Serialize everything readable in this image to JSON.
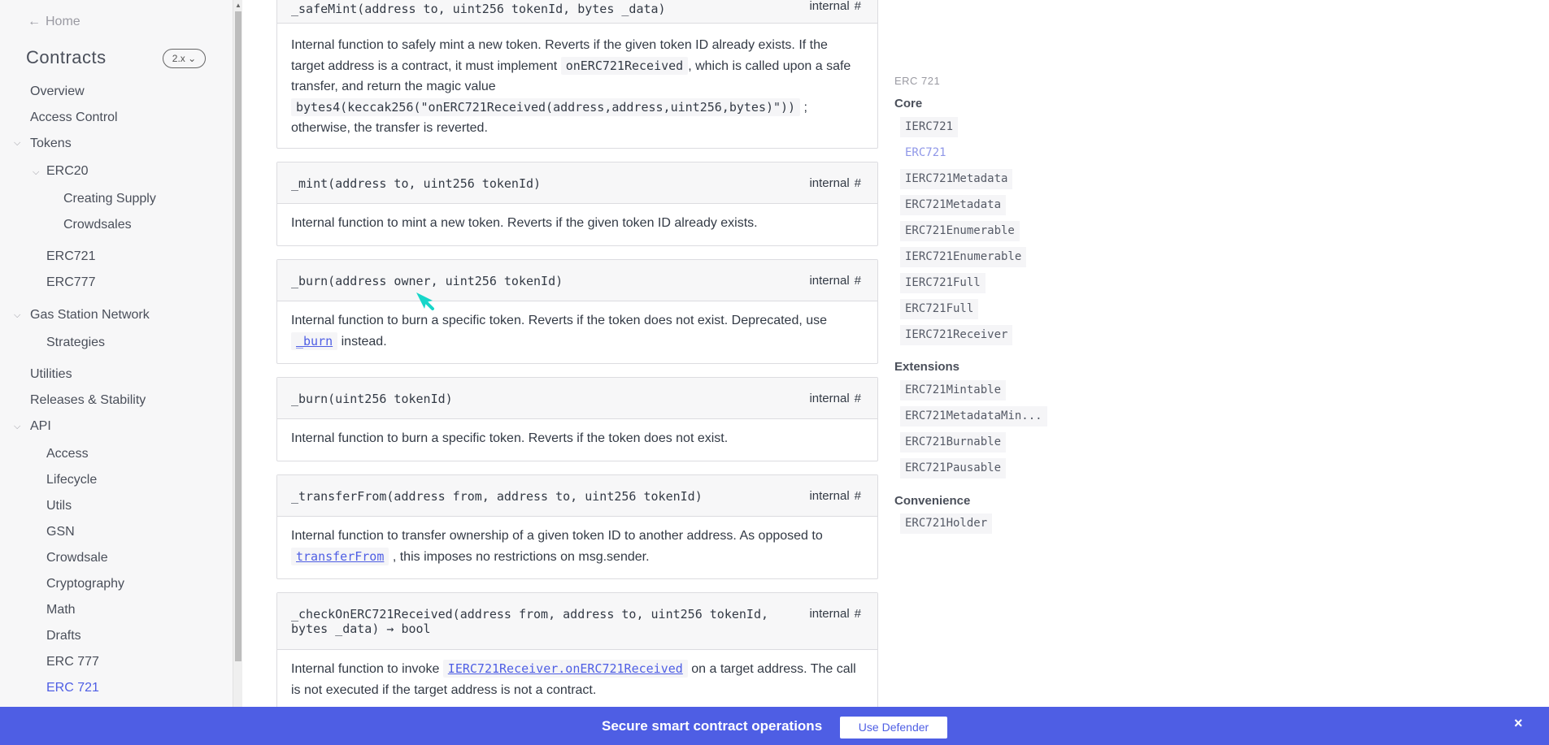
{
  "sidebar": {
    "home": "Home",
    "title": "Contracts",
    "version": "2.x",
    "items": {
      "overview": "Overview",
      "access_control": "Access Control",
      "tokens": "Tokens",
      "erc20": "ERC20",
      "creating_supply": "Creating Supply",
      "crowdsales": "Crowdsales",
      "erc721": "ERC721",
      "erc777": "ERC777",
      "gsn": "Gas Station Network",
      "strategies": "Strategies",
      "utilities": "Utilities",
      "releases": "Releases & Stability",
      "api": "API",
      "api_access": "Access",
      "api_lifecycle": "Lifecycle",
      "api_utils": "Utils",
      "api_gsn": "GSN",
      "api_crowdsale": "Crowdsale",
      "api_cryptography": "Cryptography",
      "api_math": "Math",
      "api_drafts": "Drafts",
      "api_erc777": "ERC 777",
      "api_erc721": "ERC 721"
    }
  },
  "main": {
    "safemint": {
      "sig": "_safeMint(address to, uint256 tokenId, bytes _data)",
      "visibility": "internal",
      "anchor": "#",
      "desc_1": "Internal function to safely mint a new token. Reverts if the given token ID already exists. If the target address is a contract, it must implement",
      "code_1": "onERC721Received",
      "desc_2": ", which is called upon a safe transfer, and return the magic value",
      "code_2": "bytes4(keccak256(\"onERC721Received(address,address,uint256,bytes)\"))",
      "desc_3": "; otherwise, the transfer is reverted."
    },
    "mint": {
      "sig": "_mint(address to, uint256 tokenId)",
      "visibility": "internal",
      "anchor": "#",
      "desc": "Internal function to mint a new token. Reverts if the given token ID already exists."
    },
    "burn_owner": {
      "sig": "_burn(address owner, uint256 tokenId)",
      "visibility": "internal",
      "anchor": "#",
      "desc_1": "Internal function to burn a specific token. Reverts if the token does not exist. Deprecated, use",
      "link": "_burn",
      "desc_2": "instead."
    },
    "burn": {
      "sig": "_burn(uint256 tokenId)",
      "visibility": "internal",
      "anchor": "#",
      "desc": "Internal function to burn a specific token. Reverts if the token does not exist."
    },
    "transfer": {
      "sig": "_transferFrom(address from, address to, uint256 tokenId)",
      "visibility": "internal",
      "anchor": "#",
      "desc_1": "Internal function to transfer ownership of a given token ID to another address. As opposed to",
      "link": "transferFrom",
      "desc_2": ", this imposes no restrictions on msg.sender."
    },
    "check": {
      "sig_1": "_checkOnERC721Received(address from, address to, uint256 tokenId,",
      "sig_2": "bytes _data) → bool",
      "visibility": "internal",
      "anchor": "#",
      "desc_1": "Internal function to invoke",
      "link": "IERC721Receiver.onERC721Received",
      "desc_2": "on a target address. The call",
      "desc_3": "is not executed if the target address is not a contract."
    }
  },
  "toc": {
    "label": "ERC 721",
    "core": "Core",
    "core_items": [
      "IERC721",
      "ERC721",
      "IERC721Metadata",
      "ERC721Metadata",
      "ERC721Enumerable",
      "IERC721Enumerable",
      "IERC721Full",
      "ERC721Full",
      "IERC721Receiver"
    ],
    "extensions": "Extensions",
    "ext_items": [
      "ERC721Mintable",
      "ERC721MetadataMin...",
      "ERC721Burnable",
      "ERC721Pausable"
    ],
    "convenience": "Convenience",
    "conv_items": [
      "ERC721Holder"
    ]
  },
  "banner": {
    "text": "Secure smart contract operations",
    "button": "Use Defender",
    "close": "×"
  },
  "colors": {
    "accent": "#4e5ee4",
    "sidebar_bg": "#f7f7f8"
  }
}
